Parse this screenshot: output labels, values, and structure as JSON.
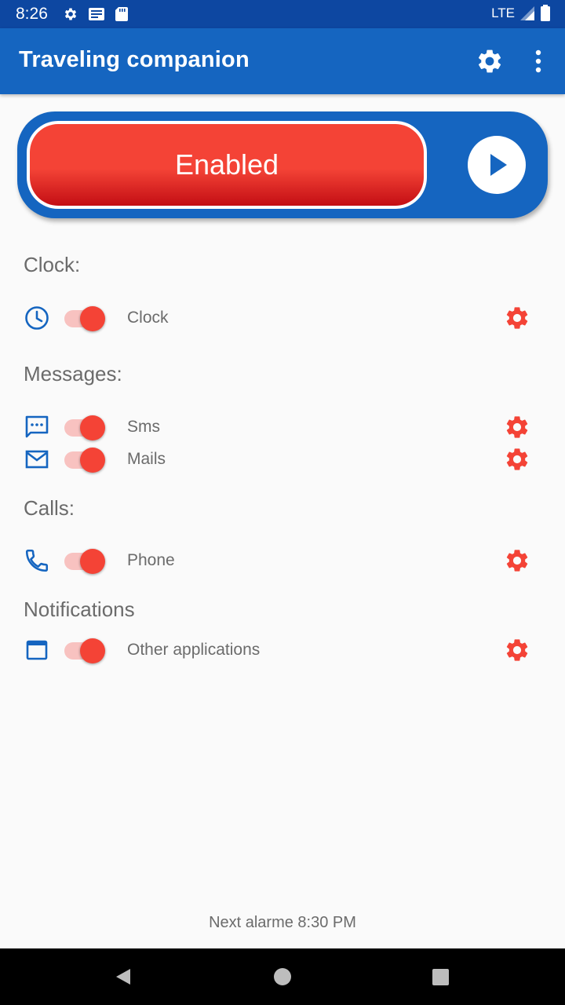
{
  "status_bar": {
    "time": "8:26",
    "network": "LTE",
    "icons": [
      "gear-icon",
      "news-icon",
      "sd-card-icon",
      "signal-icon",
      "battery-icon"
    ]
  },
  "app_bar": {
    "title": "Traveling companion",
    "icons": [
      "settings-icon",
      "more-vert-icon"
    ]
  },
  "enable_panel": {
    "button_label": "Enabled",
    "colors": {
      "panel": "#1565c0",
      "button": "#f44336"
    }
  },
  "sections": {
    "clock": {
      "title": "Clock:",
      "items": [
        {
          "label": "Clock",
          "icon": "clock-icon",
          "enabled": true
        }
      ]
    },
    "messages": {
      "title": "Messages:",
      "items": [
        {
          "label": "Sms",
          "icon": "sms-icon",
          "enabled": true
        },
        {
          "label": "Mails",
          "icon": "mail-icon",
          "enabled": true
        }
      ]
    },
    "calls": {
      "title": "Calls:",
      "items": [
        {
          "label": "Phone",
          "icon": "phone-icon",
          "enabled": true
        }
      ]
    },
    "notifications": {
      "title": "Notifications",
      "items": [
        {
          "label": "Other applications",
          "icon": "window-icon",
          "enabled": true
        }
      ]
    }
  },
  "footer": {
    "next_alarm": "Next alarme 8:30 PM"
  },
  "colors": {
    "accent": "#f44336",
    "primary": "#1565c0",
    "status_bar": "#0d47a1",
    "text": "#6b6b6b"
  }
}
